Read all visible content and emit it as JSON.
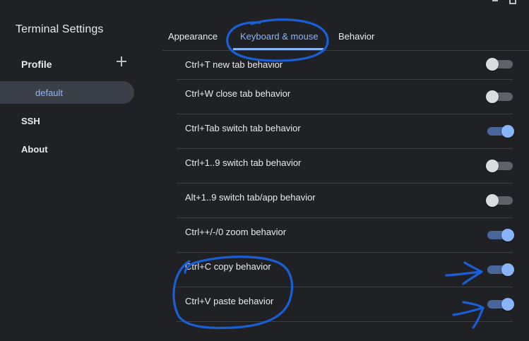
{
  "app": {
    "title": "Terminal Settings"
  },
  "sidebar": {
    "profile_heading": "Profile",
    "profiles": [
      {
        "label": "default",
        "selected": true
      }
    ],
    "items": [
      {
        "label": "SSH"
      },
      {
        "label": "About"
      }
    ]
  },
  "tabs": [
    {
      "label": "Appearance",
      "active": false
    },
    {
      "label": "Keyboard & mouse",
      "active": true
    },
    {
      "label": "Behavior",
      "active": false
    }
  ],
  "settings": [
    {
      "label": "Ctrl+T new tab behavior",
      "enabled": false
    },
    {
      "label": "Ctrl+W close tab behavior",
      "enabled": false
    },
    {
      "label": "Ctrl+Tab switch tab behavior",
      "enabled": true
    },
    {
      "label": "Ctrl+1..9 switch tab behavior",
      "enabled": false
    },
    {
      "label": "Alt+1..9 switch tab/app behavior",
      "enabled": false
    },
    {
      "label": "Ctrl++/-/0 zoom behavior",
      "enabled": true
    },
    {
      "label": "Ctrl+C copy behavior",
      "enabled": true
    },
    {
      "label": "Ctrl+V paste behavior",
      "enabled": true
    }
  ],
  "colors": {
    "background": "#202124",
    "accent": "#8ab4f8",
    "selected_item_bg": "#3b4048",
    "annotation": "#1a5fd6"
  },
  "icons": {
    "add_profile": "plus-icon"
  }
}
